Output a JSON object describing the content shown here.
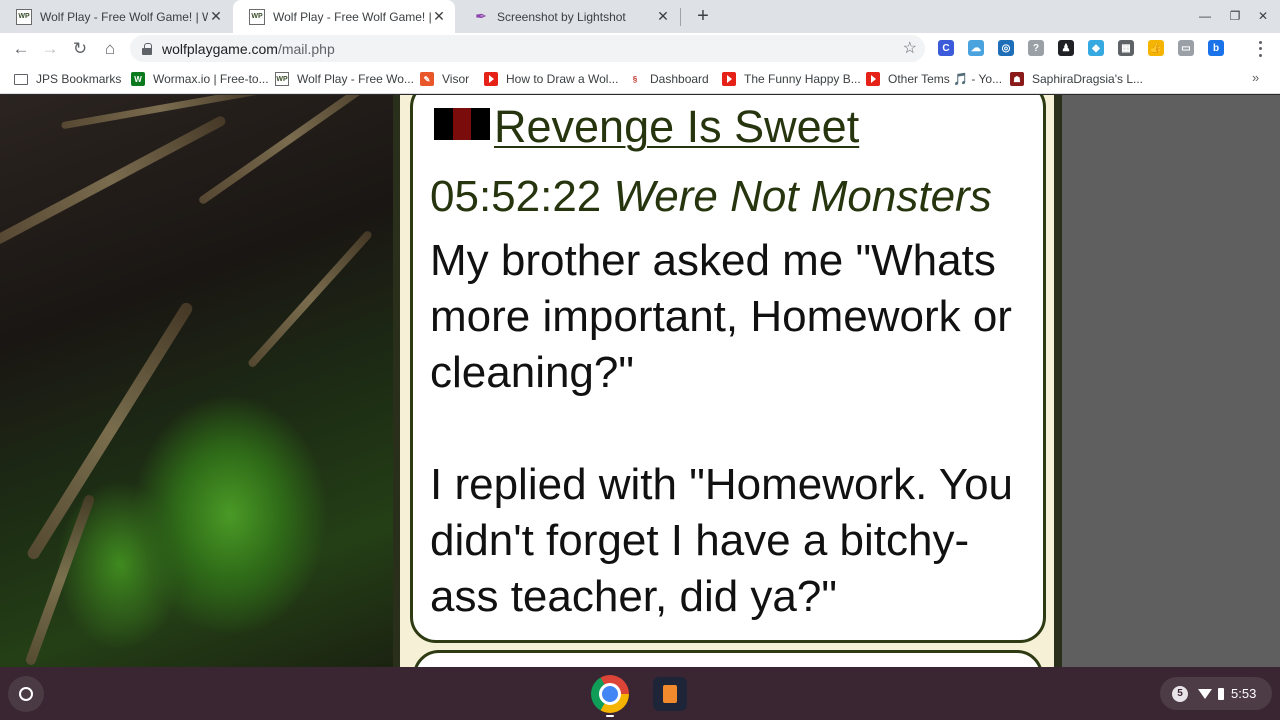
{
  "browser": {
    "tabs": [
      {
        "title": "Wolf Play - Free Wolf Game! | Wo",
        "favicon": "wolfplay-favicon",
        "active": false
      },
      {
        "title": "Wolf Play - Free Wolf Game! | Wo",
        "favicon": "wolfplay-favicon",
        "active": true
      },
      {
        "title": "Screenshot by Lightshot",
        "favicon": "lightshot-feather-icon",
        "active": false
      }
    ],
    "favicon_text": "WP",
    "new_tab_glyph": "+",
    "url_host": "wolfplaygame.com",
    "url_path": "/mail.php",
    "extensions": [
      {
        "label": "C",
        "color": "#3b5bdb"
      },
      {
        "label": "☁",
        "color": "#4aa3df"
      },
      {
        "label": "◎",
        "color": "#1e6fb8"
      },
      {
        "label": "?",
        "color": "#9aa0a6"
      },
      {
        "label": "♟",
        "color": "#202124"
      },
      {
        "label": "◆",
        "color": "#36a9e1"
      },
      {
        "label": "▦",
        "color": "#5f6368"
      },
      {
        "label": "👍",
        "color": "#f4b400"
      },
      {
        "label": "▭",
        "color": "#9aa0a6"
      },
      {
        "label": "b",
        "color": "#1a73e8"
      }
    ]
  },
  "bookmarks": [
    {
      "label": "JPS Bookmarks",
      "icon": "folder-icon"
    },
    {
      "label": "Wormax.io | Free-to...",
      "icon": "wormax-icon",
      "icon_text": "W",
      "color": "#0b7a1e"
    },
    {
      "label": "Wolf Play - Free Wo...",
      "icon": "wolfplay-favicon",
      "icon_text": "WP",
      "color": "#ffffff"
    },
    {
      "label": "Visor",
      "icon": "visor-icon",
      "icon_text": "✎",
      "color": "#e8562a"
    },
    {
      "label": "How to Draw a Wol...",
      "icon": "youtube-icon"
    },
    {
      "label": "Dashboard",
      "icon": "dashboard-icon",
      "icon_text": "§",
      "color": "#ffffff"
    },
    {
      "label": "The Funny Happy B...",
      "icon": "youtube-icon"
    },
    {
      "label": "Other Tems 🎵 - Yo...",
      "icon": "youtube-icon"
    },
    {
      "label": "SaphiraDragsia's L...",
      "icon": "saphira-icon",
      "icon_text": "☗",
      "color": "#8b1a1a"
    }
  ],
  "bookmarks_more": "»",
  "message": {
    "subject": "Revenge Is Sweet",
    "flag_colors": [
      "#000000",
      "#7a0c0c",
      "#000000"
    ],
    "time": "05:52:22",
    "sender": "Were Not Monsters",
    "body_para1": "My brother asked me \"Whats more important, Homework or cleaning?\"",
    "body_para2": "I replied with \"Homework. You didn't forget I have a bitchy-ass teacher, did ya?\""
  },
  "colors": {
    "accent_dark_green": "#27350f",
    "card_border": "#2e3a12",
    "shelf_bg": "#3a2632"
  },
  "shelf": {
    "notification_count": "5",
    "clock": "5:53"
  }
}
